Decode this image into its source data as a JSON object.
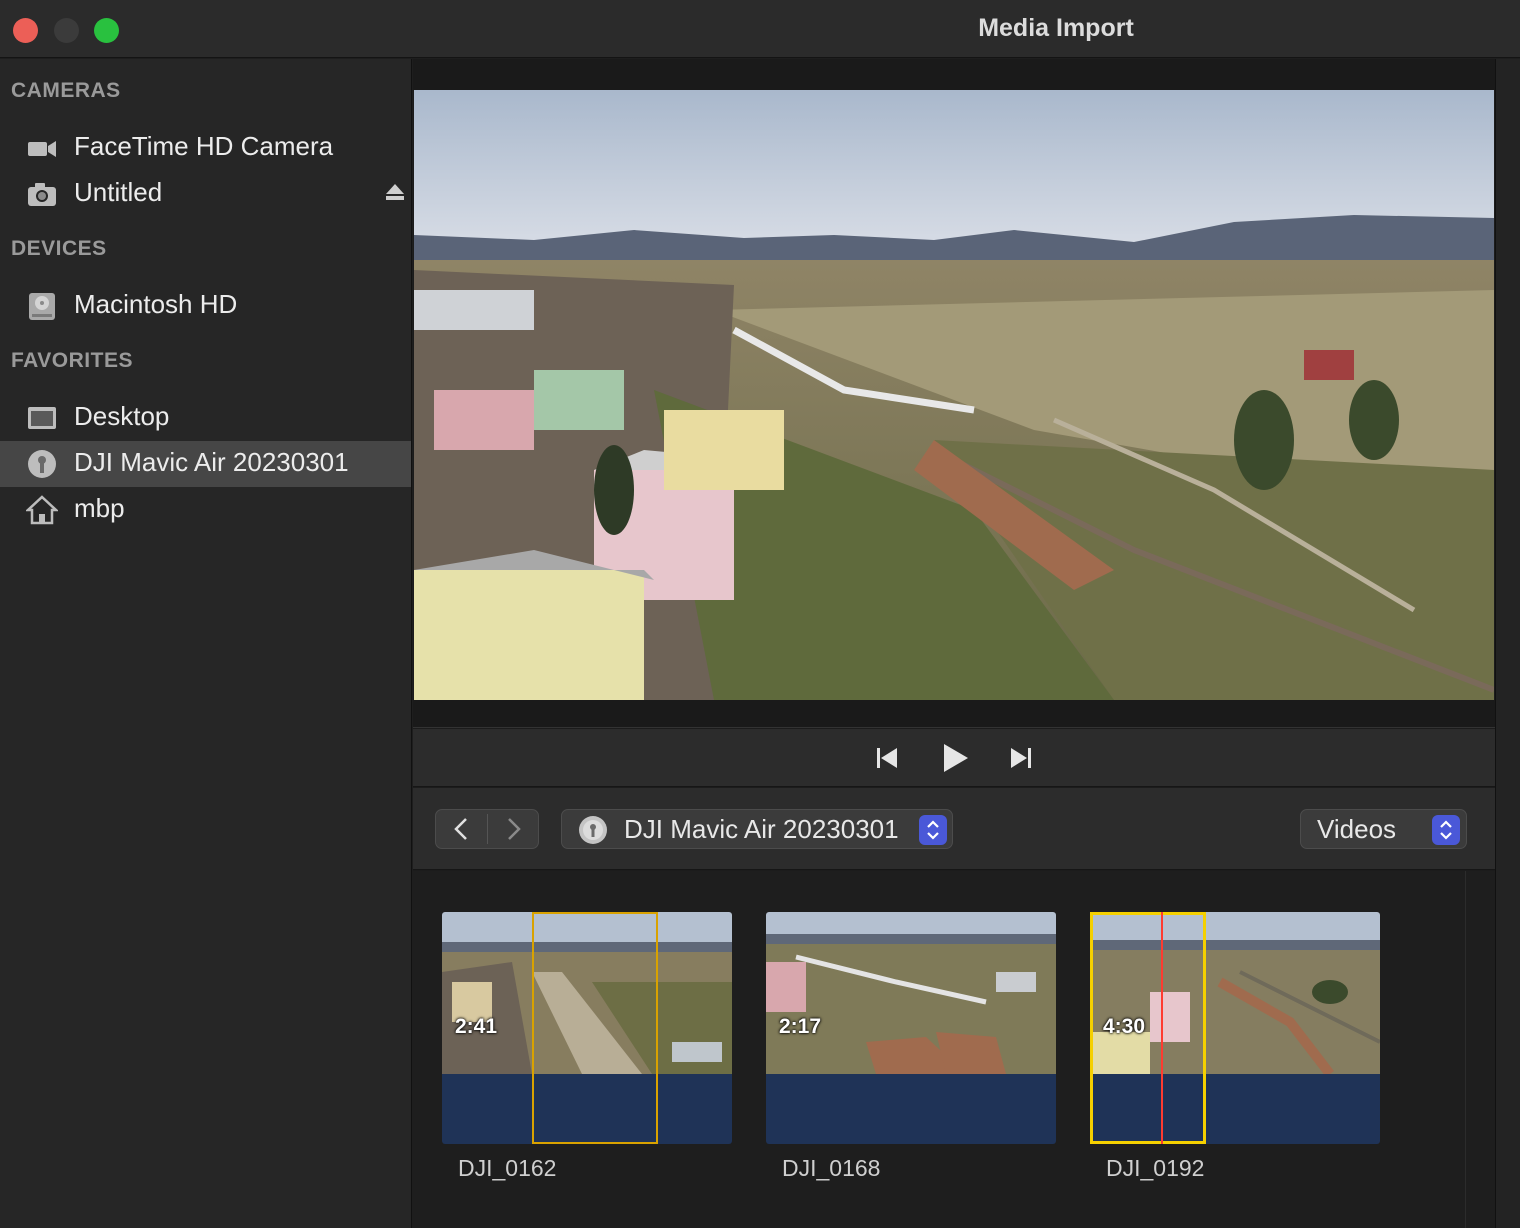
{
  "window": {
    "title": "Media Import"
  },
  "sidebar": {
    "sections": [
      {
        "header": "CAMERAS",
        "items": [
          {
            "label": "FaceTime HD Camera",
            "icon": "video-camera-icon"
          },
          {
            "label": "Untitled",
            "icon": "camera-icon",
            "ejectable": true
          }
        ]
      },
      {
        "header": "DEVICES",
        "items": [
          {
            "label": "Macintosh HD",
            "icon": "hard-drive-icon"
          }
        ]
      },
      {
        "header": "FAVORITES",
        "items": [
          {
            "label": "Desktop",
            "icon": "desktop-icon"
          },
          {
            "label": "DJI Mavic Air 20230301",
            "icon": "disk-image-icon",
            "selected": true
          },
          {
            "label": "mbp",
            "icon": "home-icon"
          }
        ]
      }
    ]
  },
  "toolbar": {
    "source_label": "DJI Mavic Air 20230301",
    "filter_label": "Videos"
  },
  "clips": [
    {
      "name": "DJI_0162",
      "duration": "2:41"
    },
    {
      "name": "DJI_0168",
      "duration": "2:17"
    },
    {
      "name": "DJI_0192",
      "duration": "4:30"
    }
  ],
  "colors": {
    "accent": "#4a58d8",
    "selection_yellow": "#f5d000",
    "range_orange": "#d9a200",
    "playhead": "#ff3b30",
    "clip_bar": "#1f3357"
  }
}
